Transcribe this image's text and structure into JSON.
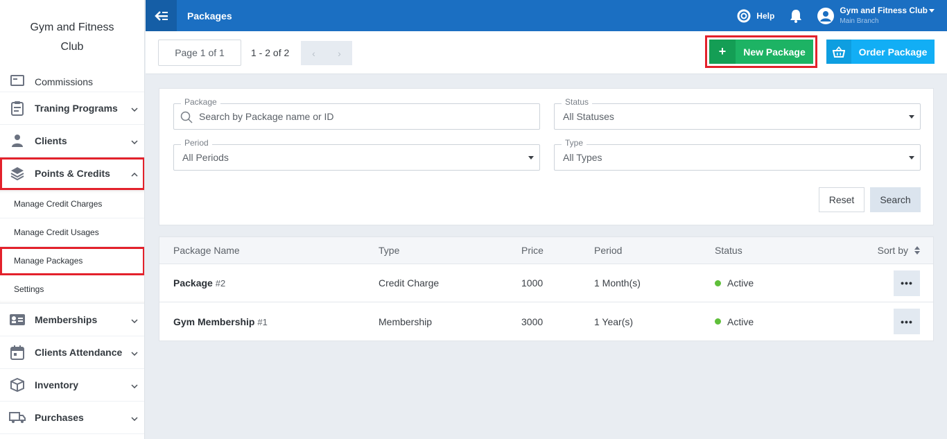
{
  "sidebar": {
    "brand": "Gym and Fitness Club",
    "items_top": [
      {
        "label": "Commissions",
        "icon": "commissions-icon"
      },
      {
        "label": "Traning Programs",
        "icon": "clipboard-icon"
      },
      {
        "label": "Clients",
        "icon": "clients-icon"
      },
      {
        "label": "Points & Credits",
        "icon": "layers-icon"
      }
    ],
    "sub_items": [
      {
        "label": "Manage Credit Charges"
      },
      {
        "label": "Manage Credit Usages"
      },
      {
        "label": "Manage Packages"
      },
      {
        "label": "Settings"
      }
    ],
    "items_bottom": [
      {
        "label": "Memberships",
        "icon": "id-card-icon"
      },
      {
        "label": "Clients Attendance",
        "icon": "calendar-icon"
      },
      {
        "label": "Inventory",
        "icon": "box-icon"
      },
      {
        "label": "Purchases",
        "icon": "truck-icon"
      }
    ]
  },
  "topbar": {
    "title": "Packages",
    "help": "Help",
    "user_name": "Gym and Fitness Club",
    "branch": "Main Branch"
  },
  "toolbar": {
    "page": "Page 1 of 1",
    "range": "1 - 2 of 2",
    "prev": "‹",
    "next": "›",
    "new_package": "New Package",
    "order_package": "Order Package"
  },
  "filters": {
    "package_label": "Package",
    "package_placeholder": "Search by Package name or ID",
    "status_label": "Status",
    "status_value": "All Statuses",
    "period_label": "Period",
    "period_value": "All Periods",
    "type_label": "Type",
    "type_value": "All Types",
    "reset": "Reset",
    "search": "Search"
  },
  "table": {
    "headers": {
      "name": "Package Name",
      "type": "Type",
      "price": "Price",
      "period": "Period",
      "status": "Status",
      "sort": "Sort by"
    },
    "rows": [
      {
        "name": "Package",
        "id": "#2",
        "type": "Credit Charge",
        "price": "1000",
        "period": "1 Month(s)",
        "status": "Active",
        "more": "•••"
      },
      {
        "name": "Gym Membership",
        "id": "#1",
        "type": "Membership",
        "price": "3000",
        "period": "1 Year(s)",
        "status": "Active",
        "more": "•••"
      }
    ]
  },
  "colors": {
    "topbar": "#1b6fc2",
    "new_button": "#1db364",
    "order_button": "#12aef5",
    "highlight": "#e3212b",
    "status_active": "#5fbf3a"
  }
}
